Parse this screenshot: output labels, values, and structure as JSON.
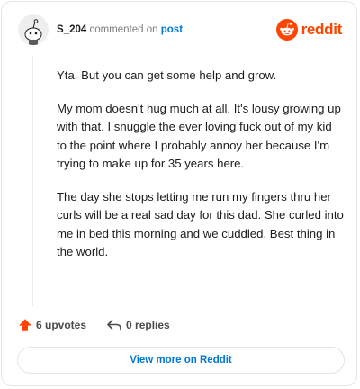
{
  "header": {
    "username": "S_204",
    "commented_text": "commented on",
    "post_link_text": "post",
    "brand_text": "reddit"
  },
  "comment": {
    "paragraphs": [
      "Yta. But you can get some help and grow.",
      "My mom doesn't hug much at all. It's lousy growing up with that. I snuggle the ever loving fuck out of my kid to the point where I probably annoy her because I'm trying to make up for 35 years here.",
      "The day she stops letting me run my fingers thru her curls will be a real sad day for this dad. She curled into me in bed this morning and we cuddled. Best thing in the world."
    ]
  },
  "actions": {
    "upvotes_label": "6 upvotes",
    "replies_label": "0 replies"
  },
  "footer": {
    "view_more_label": "View more on Reddit"
  },
  "colors": {
    "brand": "#ff4500",
    "link": "#0079d3",
    "upvote": "#ff4500"
  },
  "icons": {
    "avatar": "snoo-avatar",
    "brand": "reddit-logo-icon",
    "upvote": "upvote-arrow-icon",
    "reply": "reply-arrow-icon"
  }
}
